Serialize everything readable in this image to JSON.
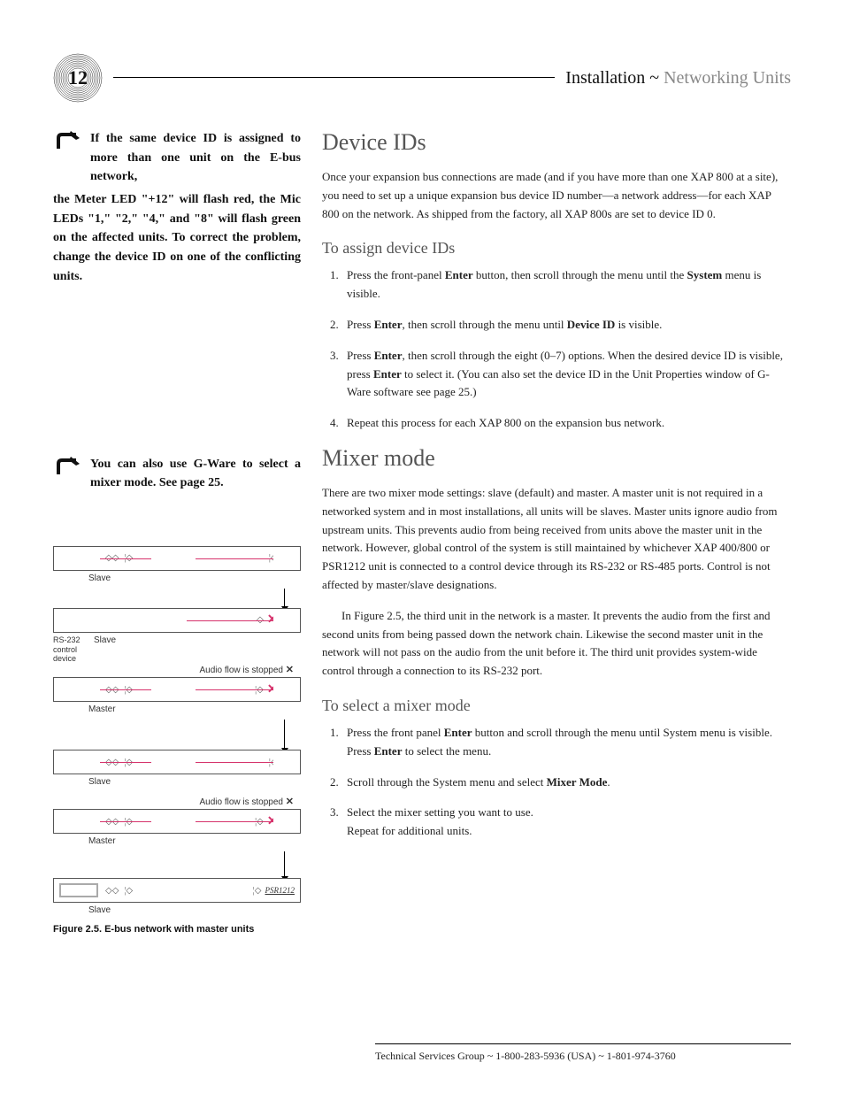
{
  "page_number": "12",
  "header": {
    "strong": "Installation ~ ",
    "light": "Networking Units"
  },
  "note1": {
    "p1a": "If the same device ID is assigned to more than one unit on the E-bus network,",
    "p1b": "the Meter LED \"+12\" will flash red, the Mic LEDs \"1,\" \"2,\" \"4,\" and \"8\" will flash green on the affected units. To correct the problem, change the device ID on one of the conflicting units."
  },
  "note2": "You can also use G-Ware to select a mixer mode. See page 25.",
  "device_ids": {
    "heading": "Device IDs",
    "intro": "Once your expansion bus connections are made (and if you have more than one XAP 800 at a site), you need to set up a unique expansion bus device ID number—a network address—for each XAP 800 on the network. As shipped from the factory, all XAP 800s are set to device ID 0.",
    "sub": "To assign device IDs",
    "steps": [
      {
        "pre": "Press the front-panel ",
        "b1": "Enter",
        "mid": " button, then scroll through the menu until the ",
        "b2": "System",
        "post": " menu is visible."
      },
      {
        "pre": "Press ",
        "b1": "Enter",
        "mid": ", then scroll through the menu until ",
        "b2": "Device ID",
        "post": " is visible."
      },
      {
        "pre": "Press ",
        "b1": "Enter",
        "mid": ", then scroll through the eight (0–7) options. When the desired device ID is visible, press ",
        "b2": "Enter",
        "post": " to select it. (You can also set the device ID in the Unit Properties window of G-Ware software see page 25.)"
      },
      {
        "pre": "Repeat this process for each XAP 800 on the expansion bus network.",
        "b1": "",
        "mid": "",
        "b2": "",
        "post": ""
      }
    ]
  },
  "mixer_mode": {
    "heading": "Mixer mode",
    "p1": "There are two mixer mode settings: slave (default) and master. A master unit is not required in a networked system and in most installations, all units will be slaves. Master units ignore audio from upstream units. This prevents audio from being received from units above the master unit in the network. However, global control of the system is still maintained by whichever XAP 400/800 or PSR1212 unit is connected to a control device through its RS-232 or RS-485 ports. Control is not affected by master/slave designations.",
    "p2": "In Figure 2.5, the third unit in the network is a master. It prevents the audio from the first and second units from being passed down the network chain. Likewise the second master unit in the network will not pass on the audio from the unit before it. The third unit provides system-wide control through a connection to its RS-232 port.",
    "sub": "To select a mixer mode",
    "steps": [
      {
        "pre": "Press the front panel ",
        "b1": "Enter",
        "mid": " button and scroll through the menu until System menu is visible. Press ",
        "b2": "Enter",
        "post": " to select the menu."
      },
      {
        "pre": "Scroll through the System menu and select ",
        "b1": "Mixer Mode",
        "mid": ".",
        "b2": "",
        "post": ""
      },
      {
        "pre": "Select the mixer setting you want to use.",
        "b1": "",
        "mid": "",
        "b2": "",
        "post": "",
        "extra": "Repeat for additional units."
      }
    ]
  },
  "figure": {
    "labels": [
      "Slave",
      "Slave",
      "Master",
      "Slave",
      "Master",
      "Slave"
    ],
    "rs232": "RS-232 control device",
    "audio_stopped": "Audio flow is stopped",
    "psr": "PSR1212",
    "caption": "Figure 2.5. E-bus network with master units"
  },
  "footer": "Technical Services Group ~ 1-800-283-5936 (USA) ~ 1-801-974-3760"
}
